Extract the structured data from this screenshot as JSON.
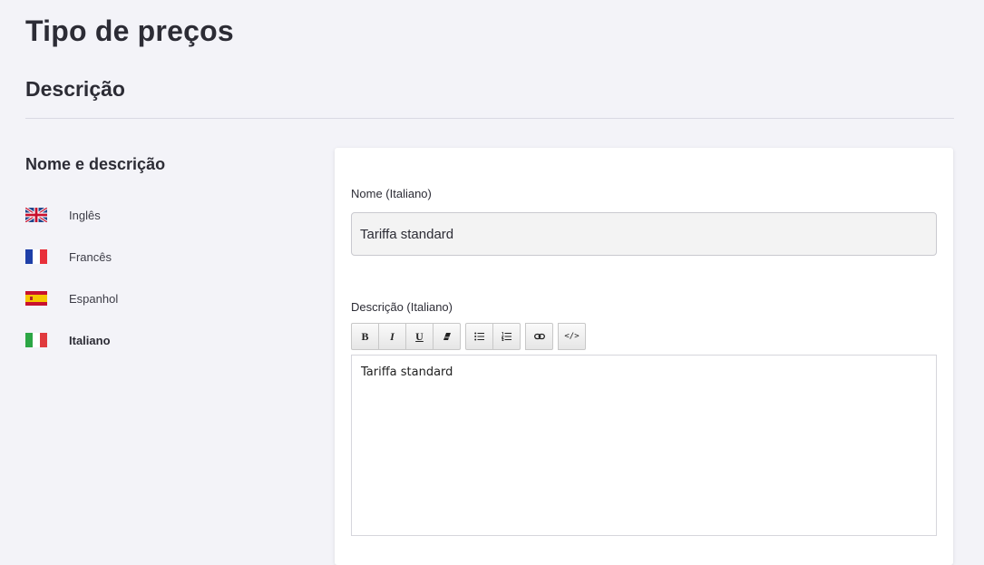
{
  "page": {
    "title": "Tipo de preços",
    "section_title": "Descrição"
  },
  "sidebar": {
    "heading": "Nome e descrição",
    "languages": [
      {
        "label": "Inglês",
        "flag": "uk-flag-icon"
      },
      {
        "label": "Francês",
        "flag": "france-flag-icon"
      },
      {
        "label": "Espanhol",
        "flag": "spain-flag-icon"
      },
      {
        "label": "Italiano",
        "flag": "italy-flag-icon",
        "active": true
      }
    ]
  },
  "form": {
    "name_label": "Nome (Italiano)",
    "name_value": "Tariffa standard",
    "description_label": "Descrição (Italiano)",
    "description_value": "Tariffa standard",
    "toolbar": {
      "bold": "B",
      "italic": "I",
      "underline": "U",
      "code": "</>"
    }
  },
  "colors": {
    "background": "#f3f3f8",
    "card": "#ffffff",
    "input_bg": "#f3f3f3",
    "text": "#2c2c35"
  }
}
